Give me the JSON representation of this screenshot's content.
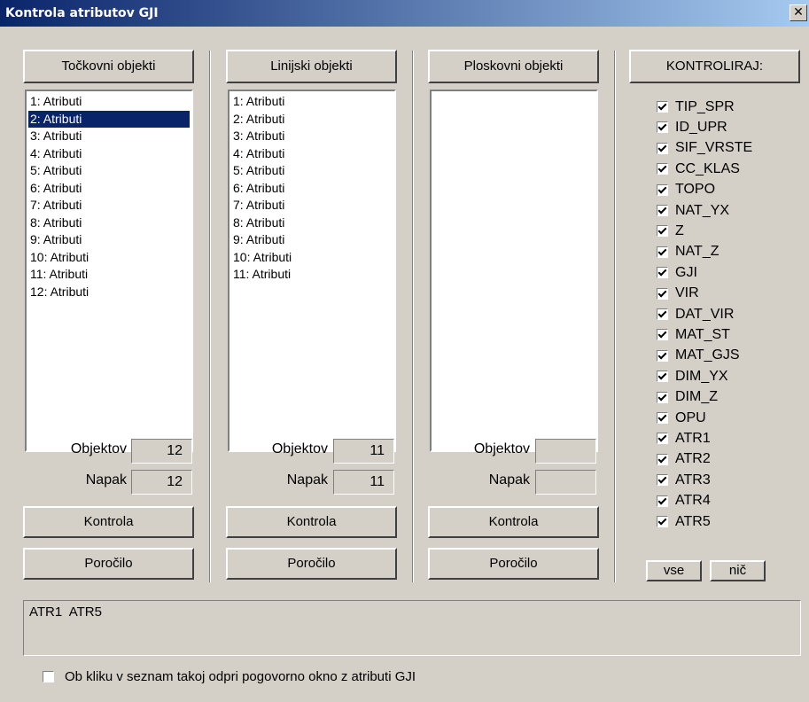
{
  "window": {
    "title": "Kontrola atributov GJI",
    "close_glyph": "✕"
  },
  "columns": [
    {
      "header": "Točkovni objekti",
      "items": [
        "1: Atributi",
        "2: Atributi",
        "3: Atributi",
        "4: Atributi",
        "5: Atributi",
        "6: Atributi",
        "7: Atributi",
        "8: Atributi",
        "9: Atributi",
        "10: Atributi",
        "11: Atributi",
        "12: Atributi"
      ],
      "selected_index": 1,
      "objektov_label": "Objektov",
      "objektov_value": "12",
      "napak_label": "Napak",
      "napak_value": "12",
      "kontrola_label": "Kontrola",
      "porocilo_label": "Poročilo"
    },
    {
      "header": "Linijski objekti",
      "items": [
        "1: Atributi",
        "2: Atributi",
        "3: Atributi",
        "4: Atributi",
        "5: Atributi",
        "6: Atributi",
        "7: Atributi",
        "8: Atributi",
        "9: Atributi",
        "10: Atributi",
        "11: Atributi"
      ],
      "selected_index": -1,
      "objektov_label": "Objektov",
      "objektov_value": "11",
      "napak_label": "Napak",
      "napak_value": "11",
      "kontrola_label": "Kontrola",
      "porocilo_label": "Poročilo"
    },
    {
      "header": "Ploskovni objekti",
      "items": [],
      "selected_index": -1,
      "objektov_label": "Objektov",
      "objektov_value": "",
      "napak_label": "Napak",
      "napak_value": "",
      "kontrola_label": "Kontrola",
      "porocilo_label": "Poročilo"
    }
  ],
  "kontroliraj": {
    "header": "KONTROLIRAJ:",
    "items": [
      {
        "label": "TIP_SPR",
        "checked": true
      },
      {
        "label": "ID_UPR",
        "checked": true
      },
      {
        "label": "SIF_VRSTE",
        "checked": true
      },
      {
        "label": "CC_KLAS",
        "checked": true
      },
      {
        "label": "TOPO",
        "checked": true
      },
      {
        "label": "NAT_YX",
        "checked": true
      },
      {
        "label": "Z",
        "checked": true
      },
      {
        "label": "NAT_Z",
        "checked": true
      },
      {
        "label": "GJI",
        "checked": true
      },
      {
        "label": "VIR",
        "checked": true
      },
      {
        "label": "DAT_VIR",
        "checked": true
      },
      {
        "label": "MAT_ST",
        "checked": true
      },
      {
        "label": "MAT_GJS",
        "checked": true
      },
      {
        "label": "DIM_YX",
        "checked": true
      },
      {
        "label": "DIM_Z",
        "checked": true
      },
      {
        "label": "OPU",
        "checked": true
      },
      {
        "label": "ATR1",
        "checked": true
      },
      {
        "label": "ATR2",
        "checked": true
      },
      {
        "label": "ATR3",
        "checked": true
      },
      {
        "label": "ATR4",
        "checked": true
      },
      {
        "label": "ATR5",
        "checked": true
      }
    ],
    "vse_label": "vse",
    "nic_label": "nič"
  },
  "output_text": "ATR1  ATR5",
  "bottom_checkbox": {
    "label": "Ob kliku v seznam takoj odpri pogovorno okno z atributi GJI",
    "checked": false
  }
}
